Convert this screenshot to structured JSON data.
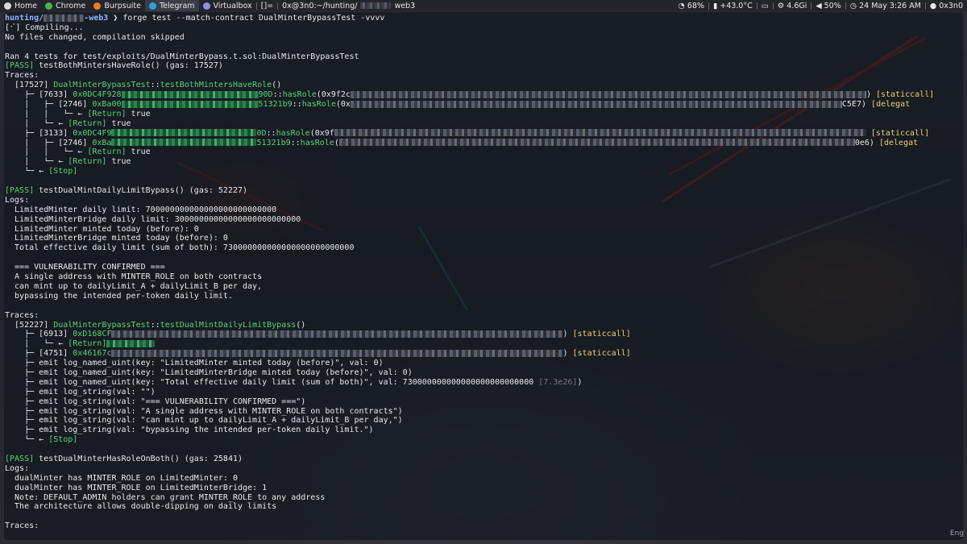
{
  "topbar": {
    "apps": [
      {
        "label": "Home",
        "active": false
      },
      {
        "label": "Chrome",
        "active": false
      },
      {
        "label": "Burpsuite",
        "active": false
      },
      {
        "label": "Telegram",
        "active": true
      },
      {
        "label": "Virtualbox",
        "active": false
      }
    ],
    "window_marker": "[]=",
    "window_title_prefix": "0x@3n0:~/hunting/",
    "window_title_suffix": "web3",
    "status": {
      "battery": "68%",
      "temp": "+43.0°C",
      "memory": "4.6Gi",
      "volume": "50%",
      "datetime": "24 May 3:26 AM",
      "user": "0x3n0"
    }
  },
  "keyboard_indicator": "Eng",
  "terminal": {
    "lines": [
      {
        "segs": [
          {
            "t": "hunting/",
            "c": "c-prompt-user"
          },
          {
            "pix": 50
          },
          {
            "t": "-web3",
            "c": "c-prompt-user"
          },
          {
            "t": " ❯ forge test --match-contract DualMinterBypassTest -vvvv",
            "c": "c-white"
          }
        ]
      },
      {
        "segs": [
          {
            "t": "[",
            "c": "c-white"
          },
          {
            "t": "⠊",
            "c": "c-green"
          },
          {
            "t": "] Compiling...",
            "c": "c-white"
          }
        ]
      },
      {
        "segs": [
          {
            "t": "No files changed, compilation skipped",
            "c": "c-white"
          }
        ]
      },
      {
        "segs": [
          {
            "t": "",
            "c": "c-white"
          }
        ]
      },
      {
        "segs": [
          {
            "t": "Ran 4 tests for test/exploits/DualMinterBypass.t.sol:DualMinterBypassTest",
            "c": "c-white"
          }
        ]
      },
      {
        "segs": [
          {
            "t": "[PASS]",
            "c": "c-green"
          },
          {
            "t": " testBothMintersHaveRole() (gas: 17527)",
            "c": "c-white"
          }
        ]
      },
      {
        "segs": [
          {
            "t": "Traces:",
            "c": "c-white"
          }
        ]
      },
      {
        "segs": [
          {
            "t": "  [17527] ",
            "c": "c-white"
          },
          {
            "t": "DualMinterBypassTest",
            "c": "c-green"
          },
          {
            "t": "::",
            "c": "c-white"
          },
          {
            "t": "testBothMintersHaveRole",
            "c": "c-green"
          },
          {
            "t": "()",
            "c": "c-white"
          }
        ]
      },
      {
        "segs": [
          {
            "t": "    ├─ [7633] ",
            "c": "c-white"
          },
          {
            "t": "0x0DC4F928",
            "c": "c-green"
          },
          {
            "pix": 170,
            "g": true
          },
          {
            "t": "90D",
            "c": "c-green"
          },
          {
            "t": "::",
            "c": "c-white"
          },
          {
            "t": "hasRole",
            "c": "c-green"
          },
          {
            "t": "(0x9f2c",
            "c": "c-white"
          },
          {
            "pix": 640
          },
          {
            "t": ") ",
            "c": "c-white"
          },
          {
            "t": "[staticcall]",
            "c": "c-yellow"
          }
        ]
      },
      {
        "segs": [
          {
            "t": "    │   ├─ [2746] ",
            "c": "c-white"
          },
          {
            "t": "0xBa00",
            "c": "c-green"
          },
          {
            "pix": 170,
            "g": true
          },
          {
            "t": "51321b9",
            "c": "c-green"
          },
          {
            "t": "::",
            "c": "c-white"
          },
          {
            "t": "hasRole",
            "c": "c-green"
          },
          {
            "t": "(0x",
            "c": "c-white"
          },
          {
            "pix": 610
          },
          {
            "t": "C5E7) ",
            "c": "c-white"
          },
          {
            "t": "[delegat",
            "c": "c-yellow"
          }
        ]
      },
      {
        "segs": [
          {
            "t": "    │   │   └─ ← ",
            "c": "c-white"
          },
          {
            "t": "[Return]",
            "c": "c-green"
          },
          {
            "t": " true",
            "c": "c-white"
          }
        ]
      },
      {
        "segs": [
          {
            "t": "    │   └─ ← ",
            "c": "c-white"
          },
          {
            "t": "[Return]",
            "c": "c-green"
          },
          {
            "t": " true",
            "c": "c-white"
          }
        ]
      },
      {
        "segs": [
          {
            "t": "    ├─ [3133] ",
            "c": "c-white"
          },
          {
            "t": "0x0DC4F9",
            "c": "c-green"
          },
          {
            "pix": 180,
            "g": true
          },
          {
            "t": "0D",
            "c": "c-green"
          },
          {
            "t": "::",
            "c": "c-white"
          },
          {
            "t": "hasRole",
            "c": "c-green"
          },
          {
            "t": "(0x9f",
            "c": "c-white"
          },
          {
            "pix": 660
          },
          {
            "t": " ",
            "c": "c-white"
          },
          {
            "t": "[staticcall]",
            "c": "c-yellow"
          }
        ]
      },
      {
        "segs": [
          {
            "t": "    │   ├─ [2746] ",
            "c": "c-white"
          },
          {
            "t": "0xBa",
            "c": "c-green"
          },
          {
            "pix": 180,
            "g": true
          },
          {
            "t": "51321b9",
            "c": "c-green"
          },
          {
            "t": "::",
            "c": "c-white"
          },
          {
            "t": "hasRole",
            "c": "c-green"
          },
          {
            "t": "(",
            "c": "c-white"
          },
          {
            "pix": 640
          },
          {
            "t": "0e6) ",
            "c": "c-white"
          },
          {
            "t": "[delegat",
            "c": "c-yellow"
          }
        ]
      },
      {
        "segs": [
          {
            "t": "    │   │   └─ ← ",
            "c": "c-white"
          },
          {
            "t": "[Return]",
            "c": "c-green"
          },
          {
            "t": " true",
            "c": "c-white"
          }
        ]
      },
      {
        "segs": [
          {
            "t": "    │   └─ ← ",
            "c": "c-white"
          },
          {
            "t": "[Return]",
            "c": "c-green"
          },
          {
            "t": " true",
            "c": "c-white"
          }
        ]
      },
      {
        "segs": [
          {
            "t": "    └─ ← ",
            "c": "c-white"
          },
          {
            "t": "[Stop]",
            "c": "c-green"
          }
        ]
      },
      {
        "segs": [
          {
            "t": "",
            "c": "c-white"
          }
        ]
      },
      {
        "segs": [
          {
            "t": "[PASS]",
            "c": "c-green"
          },
          {
            "t": " testDualMintDailyLimitBypass() (gas: 52227)",
            "c": "c-white"
          }
        ]
      },
      {
        "segs": [
          {
            "t": "Logs:",
            "c": "c-white"
          }
        ]
      },
      {
        "segs": [
          {
            "t": "  LimitedMinter daily limit: 700000000000000000000000000",
            "c": "c-white"
          }
        ]
      },
      {
        "segs": [
          {
            "t": "  LimitedMinterBridge daily limit: 30000000000000000000000000",
            "c": "c-white"
          }
        ]
      },
      {
        "segs": [
          {
            "t": "  LimitedMinter minted today (before): 0",
            "c": "c-white"
          }
        ]
      },
      {
        "segs": [
          {
            "t": "  LimitedMinterBridge minted today (before): 0",
            "c": "c-white"
          }
        ]
      },
      {
        "segs": [
          {
            "t": "  Total effective daily limit (sum of both): 730000000000000000000000000",
            "c": "c-white"
          }
        ]
      },
      {
        "segs": [
          {
            "t": "",
            "c": "c-white"
          }
        ]
      },
      {
        "segs": [
          {
            "t": "  === VULNERABILITY CONFIRMED ===",
            "c": "c-white"
          }
        ]
      },
      {
        "segs": [
          {
            "t": "  A single address with MINTER_ROLE on both contracts",
            "c": "c-white"
          }
        ]
      },
      {
        "segs": [
          {
            "t": "  can mint up to dailyLimit_A + dailyLimit_B per day,",
            "c": "c-white"
          }
        ]
      },
      {
        "segs": [
          {
            "t": "  bypassing the intended per-token daily limit.",
            "c": "c-white"
          }
        ]
      },
      {
        "segs": [
          {
            "t": "",
            "c": "c-white"
          }
        ]
      },
      {
        "segs": [
          {
            "t": "Traces:",
            "c": "c-white"
          }
        ]
      },
      {
        "segs": [
          {
            "t": "  [52227] ",
            "c": "c-white"
          },
          {
            "t": "DualMinterBypassTest",
            "c": "c-green"
          },
          {
            "t": "::",
            "c": "c-white"
          },
          {
            "t": "testDualMintDailyLimitBypass",
            "c": "c-green"
          },
          {
            "t": "()",
            "c": "c-white"
          }
        ]
      },
      {
        "segs": [
          {
            "t": "    ├─ [6913] ",
            "c": "c-white"
          },
          {
            "t": "0xD168CF",
            "c": "c-green"
          },
          {
            "pix": 560
          },
          {
            "t": ") ",
            "c": "c-white"
          },
          {
            "t": "[staticcall]",
            "c": "c-yellow"
          }
        ]
      },
      {
        "segs": [
          {
            "t": "    │   └─ ← ",
            "c": "c-white"
          },
          {
            "t": "[Return]",
            "c": "c-green"
          },
          {
            "pix": 60,
            "g": true
          }
        ]
      },
      {
        "segs": [
          {
            "t": "    ├─ [4751] ",
            "c": "c-white"
          },
          {
            "t": "0x46167c",
            "c": "c-green"
          },
          {
            "pix": 560
          },
          {
            "t": ") ",
            "c": "c-white"
          },
          {
            "t": "[staticcall]",
            "c": "c-yellow"
          }
        ]
      },
      {
        "segs": [
          {
            "t": "    ├─ emit log_named_uint(key: ",
            "c": "c-white"
          },
          {
            "t": "\"LimitedMinter minted today (before)\"",
            "c": "c-white"
          },
          {
            "t": ", val: 0)",
            "c": "c-white"
          }
        ]
      },
      {
        "segs": [
          {
            "t": "    ├─ emit log_named_uint(key: \"LimitedMinterBridge minted today (before)\", val: 0)",
            "c": "c-white"
          }
        ]
      },
      {
        "segs": [
          {
            "t": "    ├─ emit log_named_uint(key: \"Total effective daily limit (sum of both)\", val: 730000000000000000000000000 ",
            "c": "c-white"
          },
          {
            "t": "[7.3e26]",
            "c": "c-dim"
          },
          {
            "t": ")",
            "c": "c-white"
          }
        ]
      },
      {
        "segs": [
          {
            "t": "    ├─ emit log_string(val: \"\")",
            "c": "c-white"
          }
        ]
      },
      {
        "segs": [
          {
            "t": "    ├─ emit log_string(val: \"=== VULNERABILITY CONFIRMED ===\")",
            "c": "c-white"
          }
        ]
      },
      {
        "segs": [
          {
            "t": "    ├─ emit log_string(val: \"A single address with MINTER_ROLE on both contracts\")",
            "c": "c-white"
          }
        ]
      },
      {
        "segs": [
          {
            "t": "    ├─ emit log_string(val: \"can mint up to dailyLimit_A + dailyLimit_B per day,\")",
            "c": "c-white"
          }
        ]
      },
      {
        "segs": [
          {
            "t": "    ├─ emit log_string(val: \"bypassing the intended per-token daily limit.\")",
            "c": "c-white"
          }
        ]
      },
      {
        "segs": [
          {
            "t": "    └─ ← ",
            "c": "c-white"
          },
          {
            "t": "[Stop]",
            "c": "c-green"
          }
        ]
      },
      {
        "segs": [
          {
            "t": "",
            "c": "c-white"
          }
        ]
      },
      {
        "segs": [
          {
            "t": "[PASS]",
            "c": "c-green"
          },
          {
            "t": " testDualMinterHasRoleOnBoth() (gas: 25841)",
            "c": "c-white"
          }
        ]
      },
      {
        "segs": [
          {
            "t": "Logs:",
            "c": "c-white"
          }
        ]
      },
      {
        "segs": [
          {
            "t": "  dualMinter has MINTER_ROLE on LimitedMinter: 0",
            "c": "c-white"
          }
        ]
      },
      {
        "segs": [
          {
            "t": "  dualMinter has MINTER_ROLE on LimitedMinterBridge: 1",
            "c": "c-white"
          }
        ]
      },
      {
        "segs": [
          {
            "t": "  Note: DEFAULT_ADMIN holders can grant MINTER_ROLE to any address",
            "c": "c-white"
          }
        ]
      },
      {
        "segs": [
          {
            "t": "  The architecture allows double-dipping on daily limits",
            "c": "c-white"
          }
        ]
      },
      {
        "segs": [
          {
            "t": "",
            "c": "c-white"
          }
        ]
      },
      {
        "segs": [
          {
            "t": "Traces:",
            "c": "c-white"
          }
        ]
      }
    ]
  }
}
